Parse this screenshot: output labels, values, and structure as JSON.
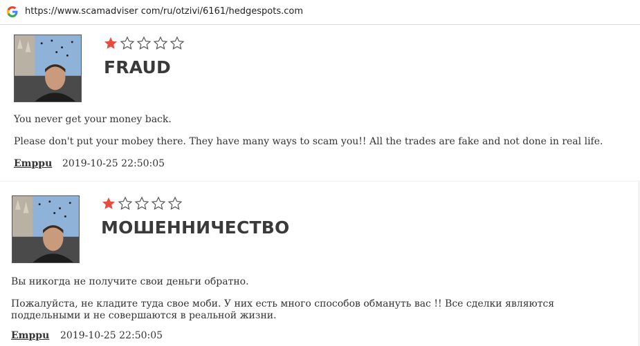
{
  "browser": {
    "url": "https://www.scamadviser com/ru/otzivi/6161/hedgespots.com"
  },
  "colors": {
    "star_filled": "#e74c3c",
    "star_empty": "#555555"
  },
  "reviews": [
    {
      "rating": 1,
      "max_rating": 5,
      "title": "FRAUD",
      "paragraphs": [
        "You never get your money back.",
        "Please don't put your mobey there. They have many ways to scam you!! All the trades are fake and not done in real life."
      ],
      "author": "Emppu",
      "date": "2019-10-25 22:50:05"
    },
    {
      "rating": 1,
      "max_rating": 5,
      "title": "МОШЕННИЧЕСТВО",
      "paragraphs": [
        "Вы никогда не получите свои деньги обратно.",
        "Пожалуйста, не кладите туда свое моби. У них есть много способов обмануть вас !! Все сделки являются поддельными и не совершаются в реальной жизни."
      ],
      "author": "Emppu",
      "date": "2019-10-25 22:50:05"
    }
  ]
}
